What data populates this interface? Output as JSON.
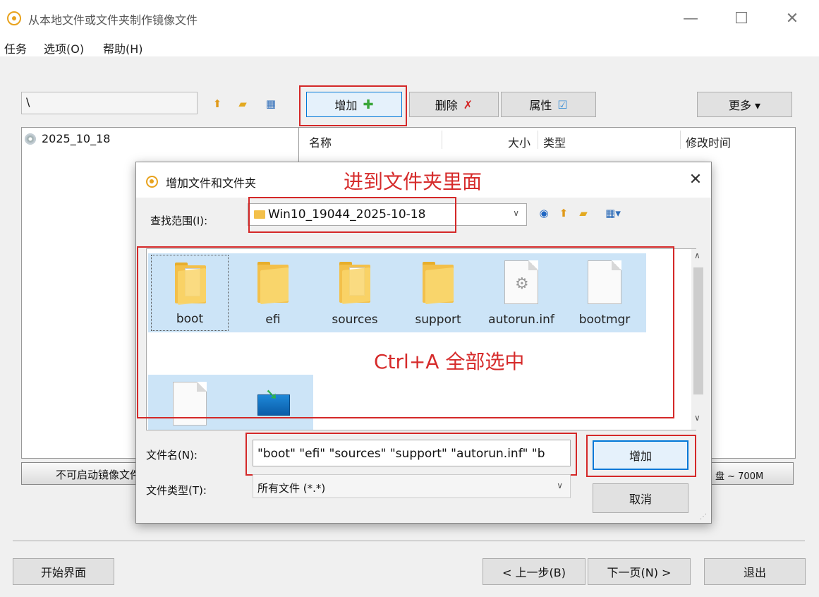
{
  "window": {
    "title": "从本地文件或文件夹制作镜像文件",
    "minimize": "—",
    "maximize": "☐",
    "close": "✕"
  },
  "menu": [
    "任务",
    "选项(O)",
    "帮助(H)"
  ],
  "toolbar": {
    "path_value": "\\",
    "add_label": "增加",
    "delete_label": "删除",
    "properties_label": "属性",
    "more_label": "更多 ▾"
  },
  "tree": {
    "root_label": "2025_10_18"
  },
  "file_list": {
    "columns": [
      "名称",
      "大小",
      "类型",
      "修改时间"
    ]
  },
  "combos": {
    "nonboot": "不可启动镜像文件",
    "disk": "盘 ~ 700M"
  },
  "bottom_buttons": {
    "home": "开始界面",
    "prev": "< 上一步(B)",
    "next": "下一页(N) >",
    "exit": "退出"
  },
  "dialog": {
    "title": "增加文件和文件夹",
    "close": "✕",
    "annot_top": "进到文件夹里面",
    "annot_middle": "Ctrl+A 全部选中",
    "lookin_label": "查找范围(I):",
    "lookin_value": "Win10_19044_2025-10-18",
    "files": [
      {
        "name": "boot",
        "kind": "folder"
      },
      {
        "name": "efi",
        "kind": "folder"
      },
      {
        "name": "sources",
        "kind": "folder"
      },
      {
        "name": "support",
        "kind": "folder"
      },
      {
        "name": "autorun.inf",
        "kind": "settings-file"
      },
      {
        "name": "bootmgr",
        "kind": "file"
      },
      {
        "name": "",
        "kind": "file"
      },
      {
        "name": "",
        "kind": "setup-exe"
      }
    ],
    "filename_label": "文件名(N):",
    "filename_value": "\"boot\" \"efi\" \"sources\" \"support\" \"autorun.inf\" \"b",
    "filetype_label": "文件类型(T):",
    "filetype_value": "所有文件 (*.*)",
    "add_button": "增加",
    "cancel_button": "取消"
  },
  "colors": {
    "annotation_red": "#d62b2b",
    "selection_blue": "#cce4f7",
    "accent_blue": "#0078d7",
    "folder_yellow": "#f3c04a"
  }
}
